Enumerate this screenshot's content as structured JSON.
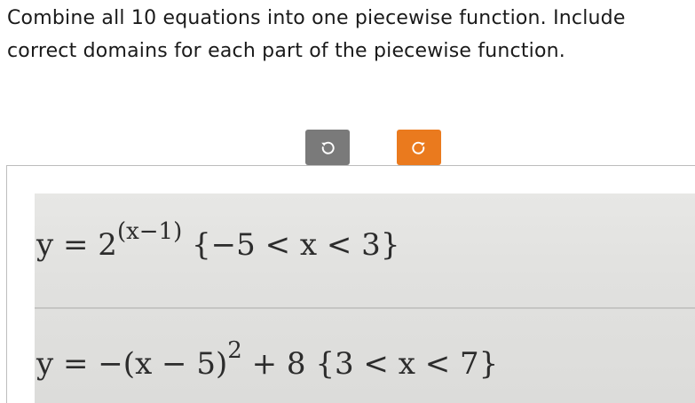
{
  "instructions": {
    "line1": "Combine all 10 equations into one piecewise function. Include",
    "line2": "correct domains for each part of the piecewise function."
  },
  "toolbar": {
    "undo_icon": "undo-icon",
    "redo_icon": "redo-icon",
    "undo_color": "#7a7a7a",
    "redo_color": "#ea7a1e"
  },
  "equations": [
    {
      "lhs": "y = 2",
      "exponent": "(x−1)",
      "domain": "{−5 < x < 3}"
    },
    {
      "lhs": "y = −(x − 5)",
      "exponent": "2",
      "rest": " + 8",
      "domain": "{3 < x < 7}"
    }
  ]
}
